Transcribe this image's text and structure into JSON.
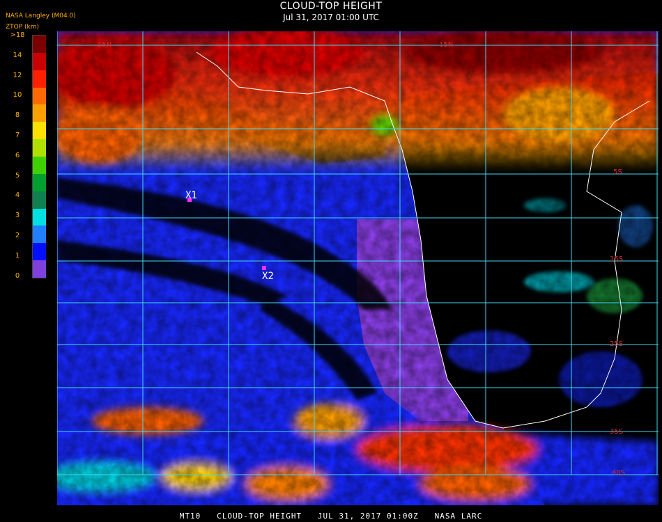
{
  "header": {
    "title": "CLOUD-TOP HEIGHT",
    "subtitle": "Jul 31, 2017 01:00 UTC",
    "provider": "NASA Langley (M04.0)",
    "units_label": "ZTOP (km)"
  },
  "legend": {
    "ticks": [
      ">18",
      "14",
      "12",
      "10",
      "8",
      "7",
      "6",
      "5",
      "4",
      "3",
      "2",
      "1",
      "0"
    ],
    "colors": [
      "#7a0000",
      "#c80000",
      "#ff2000",
      "#ff6a00",
      "#ffa000",
      "#ffe000",
      "#b0e000",
      "#40d000",
      "#00a030",
      "#108050",
      "#00e0e0",
      "#2080ff",
      "#0010ff",
      "#8040e0"
    ]
  },
  "map": {
    "markers": [
      {
        "label": "X1"
      },
      {
        "label": "X2"
      }
    ],
    "lat_labels": [
      "15N",
      "15N",
      "5S",
      "15S",
      "25S",
      "35S",
      "40S"
    ],
    "grid_color": "#40d8f0"
  },
  "footer": {
    "text": "MT10   CLOUD-TOP HEIGHT   JUL 31, 2017 01:00Z   NASA LARC"
  }
}
